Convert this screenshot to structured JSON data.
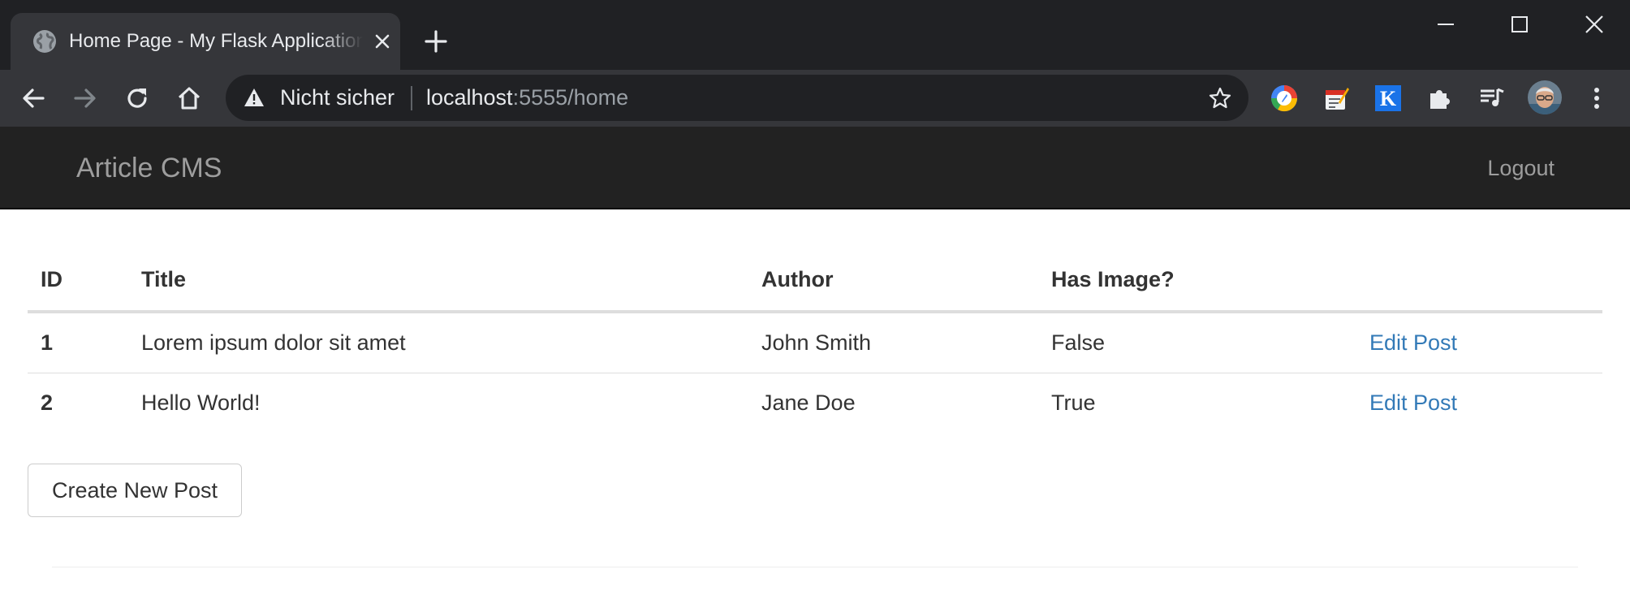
{
  "browser": {
    "tab": {
      "title": "Home Page - My Flask Application",
      "favicon": "globe-icon",
      "close_icon": "close-icon"
    },
    "new_tab_icon": "plus-icon",
    "window_controls": [
      "minimize-icon",
      "maximize-icon",
      "close-icon"
    ],
    "nav_icons": [
      "back-arrow-icon",
      "forward-arrow-icon",
      "reload-icon",
      "home-icon"
    ],
    "omnibox": {
      "security_label": "Nicht sicher",
      "url_host": "localhost",
      "url_rest": ":5555/home",
      "bookmark_icon": "star-icon"
    },
    "extensions": [
      "chrome-ext-icon",
      "notes-ext-icon",
      "k-ext-icon",
      "puzzle-icon",
      "media-playlist-icon",
      "profile-avatar",
      "kebab-menu-icon"
    ],
    "extension_k_letter": "K",
    "colors": {
      "chrome_dark": "#202124",
      "chrome_toolbar": "#35363a"
    }
  },
  "navbar": {
    "brand": "Article CMS",
    "logout": "Logout",
    "background": "#222222"
  },
  "table": {
    "headers": {
      "id": "ID",
      "title": "Title",
      "author": "Author",
      "has_image": "Has Image?"
    },
    "rows": [
      {
        "id": "1",
        "title": "Lorem ipsum dolor sit amet",
        "author": "John Smith",
        "has_image": "False",
        "action": "Edit Post"
      },
      {
        "id": "2",
        "title": "Hello World!",
        "author": "Jane Doe",
        "has_image": "True",
        "action": "Edit Post"
      }
    ]
  },
  "create_button": "Create New Post",
  "colors": {
    "link": "#337ab7",
    "text": "#333333"
  }
}
